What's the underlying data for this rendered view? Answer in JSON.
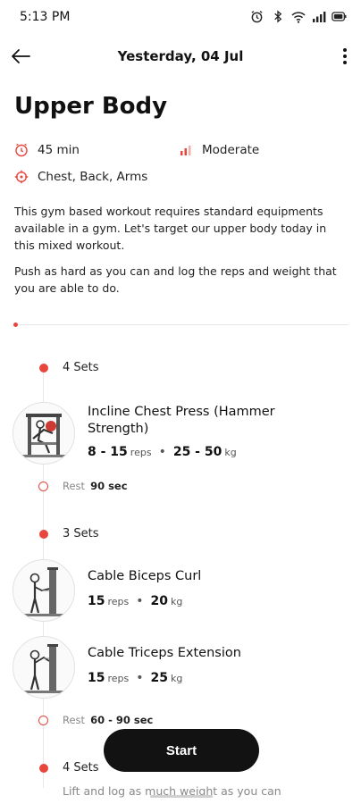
{
  "status_bar": {
    "time": "5:13 PM",
    "icons": [
      "alarm-icon",
      "bluetooth-icon",
      "wifi-icon",
      "signal-icon",
      "battery-icon"
    ]
  },
  "header": {
    "title": "Yesterday, 04 Jul",
    "back_icon": "arrow-left-icon",
    "more_icon": "more-vertical-icon"
  },
  "workout": {
    "title": "Upper Body",
    "duration": "45 min",
    "intensity": "Moderate",
    "muscles": "Chest, Back, Arms",
    "description_1": "This gym based workout requires standard equipments available in a gym. Let's target our upper body today in this mixed workout.",
    "description_2": "Push as hard as you can and log the reps and weight that you are able to do."
  },
  "colors": {
    "accent": "#e8453c",
    "button": "#121212"
  },
  "blocks": [
    {
      "sets_label": "4 Sets",
      "exercises": [
        {
          "name": "Incline Chest Press (Hammer Strength)",
          "reps": "8 - 15",
          "reps_unit": "reps",
          "weight": "25 - 50",
          "weight_unit": "kg"
        }
      ],
      "rest_label": "Rest",
      "rest_value": "90 sec"
    },
    {
      "sets_label": "3 Sets",
      "exercises": [
        {
          "name": "Cable Biceps Curl",
          "reps": "15",
          "reps_unit": "reps",
          "weight": "20",
          "weight_unit": "kg"
        },
        {
          "name": "Cable Triceps Extension",
          "reps": "15",
          "reps_unit": "reps",
          "weight": "25",
          "weight_unit": "kg"
        }
      ],
      "rest_label": "Rest",
      "rest_value": "60 - 90 sec"
    },
    {
      "sets_label": "4 Sets",
      "note": "Lift and log as much weight as you can"
    }
  ],
  "start_button": "Start"
}
